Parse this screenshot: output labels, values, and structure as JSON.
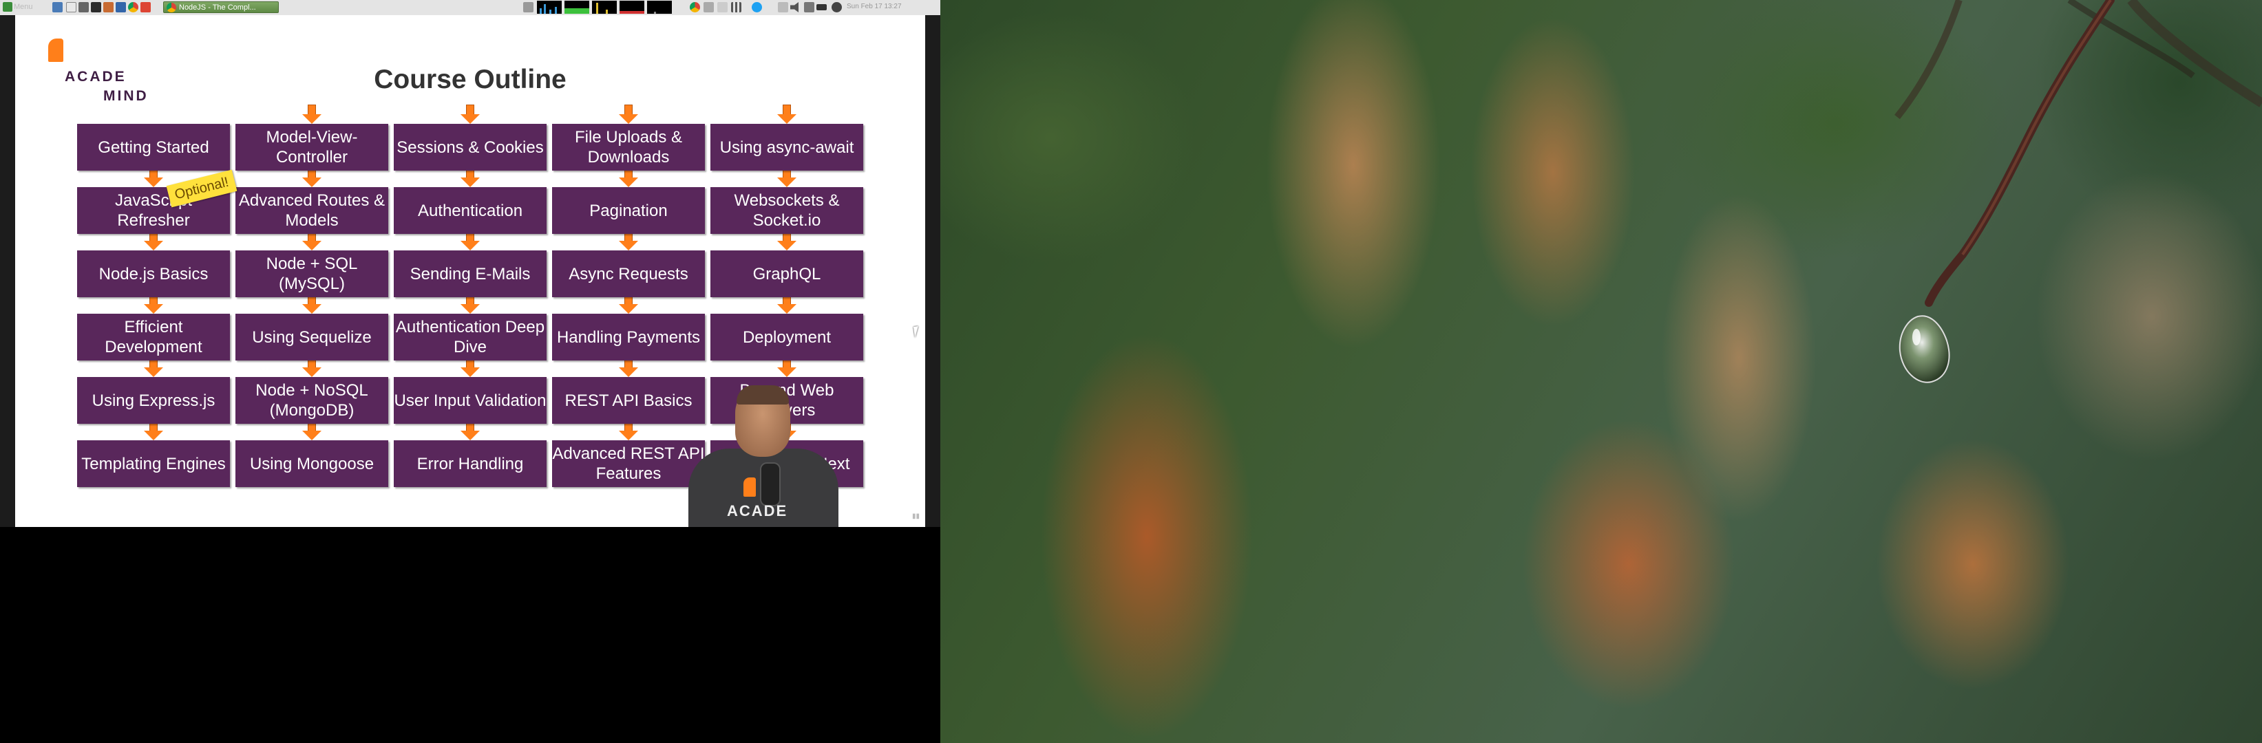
{
  "taskbar": {
    "menu_label": "Menu",
    "active_window_title": "NodeJS - The Compl...",
    "clock": "Sun Feb 17 13:27"
  },
  "slide": {
    "logo_top": "ACADE",
    "logo_bottom": "MIND",
    "title": "Course Outline",
    "optional_badge": "Optional!",
    "columns": [
      [
        "Getting Started",
        "JavaScript Refresher",
        "Node.js Basics",
        "Efficient Development",
        "Using Express.js",
        "Templating Engines"
      ],
      [
        "Model-View-Controller",
        "Advanced Routes & Models",
        "Node + SQL (MySQL)",
        "Using Sequelize",
        "Node + NoSQL (MongoDB)",
        "Using Mongoose"
      ],
      [
        "Sessions & Cookies",
        "Authentication",
        "Sending E-Mails",
        "Authentication Deep Dive",
        "User Input Validation",
        "Error Handling"
      ],
      [
        "File Uploads & Downloads",
        "Pagination",
        "Async Requests",
        "Handling Payments",
        "REST API Basics",
        "Advanced REST API Features"
      ],
      [
        "Using async-await",
        "Websockets & Socket.io",
        "GraphQL",
        "Deployment",
        "Beyond Web Servers",
        "Roadmap & Next"
      ]
    ],
    "presenter_shirt_logo": "ACADE"
  },
  "colors": {
    "box_purple": "#59275b",
    "arrow_orange": "#ff7f1a",
    "badge_yellow": "#ffe13c",
    "taskbar_gray": "#e4e4e4"
  }
}
